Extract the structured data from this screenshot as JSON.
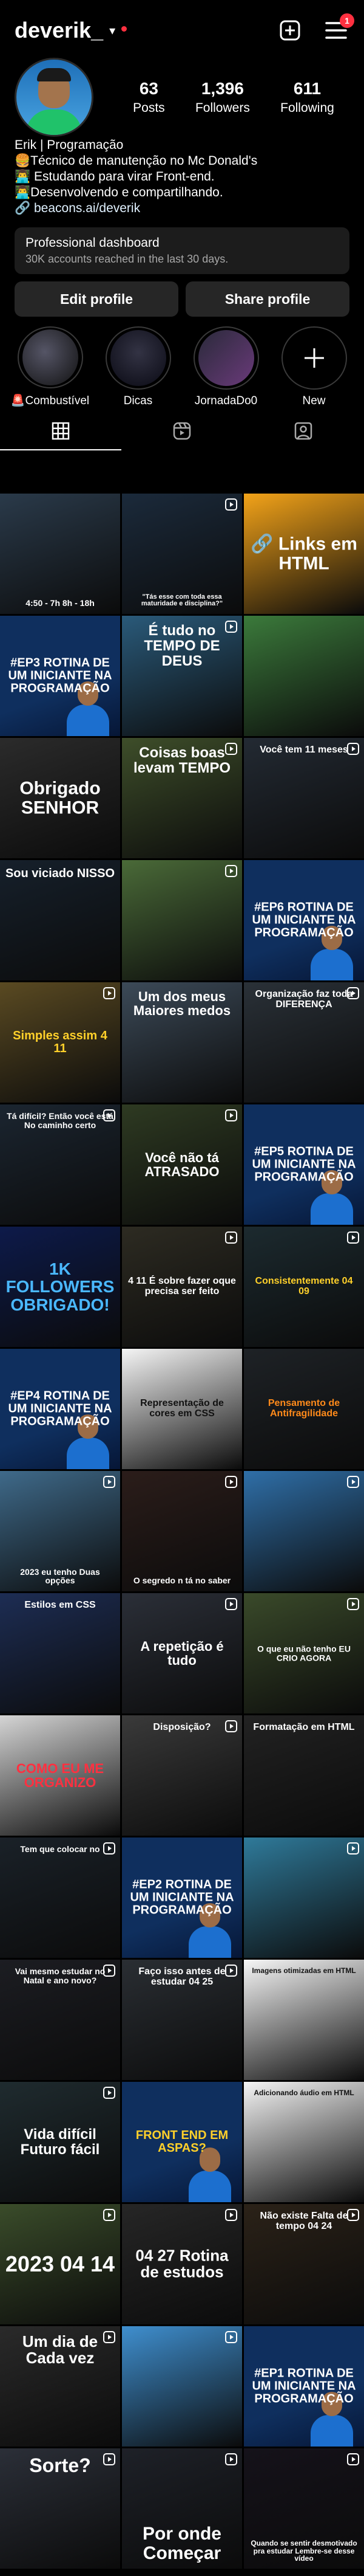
{
  "header": {
    "username": "deverik_",
    "notif_count": "1"
  },
  "stats": [
    {
      "num": "63",
      "label": "Posts"
    },
    {
      "num": "1,396",
      "label": "Followers"
    },
    {
      "num": "611",
      "label": "Following"
    }
  ],
  "bio": {
    "name": "Erik | Programação",
    "lines": [
      "🍔Técnico de manutenção no Mc Donald's",
      "👨‍💻 Estudando para virar Front-end.",
      "👨‍💻Desenvolvendo e compartilhando."
    ],
    "link": "🔗 beacons.ai/deverik"
  },
  "dashboard": {
    "title": "Professional dashboard",
    "subtitle": "30K accounts reached in the last 30 days."
  },
  "buttons": {
    "edit": "Edit profile",
    "share": "Share profile"
  },
  "highlights": [
    "🚨Combustível",
    "Dicas",
    "JornadaDo0",
    "New"
  ],
  "posts": [
    {
      "bg": "#2a3a4a",
      "text": "4:50 - 7h   8h - 18h",
      "size": 14,
      "pos": "bottom",
      "color": "#ffffff"
    },
    {
      "bg": "#1b2a3b",
      "text": "\"Tás esse com toda essa maturidade e disciplina?\"",
      "size": 11,
      "pos": "bottom",
      "color": "#ffffff",
      "reel": true
    },
    {
      "bg": "#f3a319",
      "text": "🔗 Links em HTML",
      "size": 30,
      "pos": "middle",
      "color": "#ffffff"
    },
    {
      "bg": "#0f2f5e",
      "text": "#EP3 ROTINA DE UM INICIANTE NA PROGRAMAÇÃO",
      "size": 20,
      "pos": "middle",
      "color": "#ffffff",
      "accent": "#ff3040"
    },
    {
      "bg": "#2a5a7a",
      "text": "É tudo no TEMPO DE DEUS",
      "size": 24,
      "pos": "top",
      "color": "#ffffff",
      "reel": true
    },
    {
      "bg": "#3b7a3b",
      "text": "",
      "size": 14,
      "pos": "bottom",
      "color": "#ffffff"
    },
    {
      "bg": "#2b2b2b",
      "text": "Obrigado SENHOR",
      "size": 30,
      "pos": "middle",
      "color": "#ffffff"
    },
    {
      "bg": "#3e4e2a",
      "text": "Coisas boas levam TEMPO",
      "size": 24,
      "pos": "top",
      "color": "#ffffff",
      "reel": true
    },
    {
      "bg": "#232a33",
      "text": "Você tem 11 meses",
      "size": 16,
      "pos": "top",
      "color": "#ffffff",
      "reel": true
    },
    {
      "bg": "#16202b",
      "text": "Sou viciado NISSO",
      "size": 20,
      "pos": "top",
      "color": "#ffffff"
    },
    {
      "bg": "#4a6a38",
      "text": "",
      "size": 14,
      "pos": "bottom",
      "color": "#ffffff",
      "reel": true
    },
    {
      "bg": "#0f2f5e",
      "text": "#EP6 ROTINA DE UM INICIANTE NA PROGRAMAÇÃO",
      "size": 20,
      "pos": "middle",
      "color": "#ffffff",
      "accent": "#ff3040"
    },
    {
      "bg": "#5a4a22",
      "text": "Simples assim 4 11",
      "size": 20,
      "pos": "middle",
      "color": "#ffd02a",
      "reel": true
    },
    {
      "bg": "#3c4a58",
      "text": "Um dos meus Maiores medos",
      "size": 22,
      "pos": "top",
      "color": "#ffffff"
    },
    {
      "bg": "#2a3138",
      "text": "Organização faz toda DIFERENÇA",
      "size": 16,
      "pos": "top",
      "color": "#ffffff",
      "reel": true
    },
    {
      "bg": "#1b2530",
      "text": "Tá difícil? Então você está No caminho certo",
      "size": 14,
      "pos": "top",
      "color": "#ffffff",
      "reel": true
    },
    {
      "bg": "#2e3a22",
      "text": "Você não tá ATRASADO",
      "size": 22,
      "pos": "middle",
      "color": "#ffffff",
      "reel": true
    },
    {
      "bg": "#0f2f5e",
      "text": "#EP5 ROTINA DE UM INICIANTE NA PROGRAMAÇÃO",
      "size": 20,
      "pos": "middle",
      "color": "#ffffff",
      "accent": "#ff3040"
    },
    {
      "bg": "#0d1a4a",
      "text": "1K FOLLOWERS OBRIGADO!",
      "size": 28,
      "pos": "middle",
      "color": "#4ab8ff"
    },
    {
      "bg": "#2d2b22",
      "text": "4 11 É sobre fazer oque precisa ser feito",
      "size": 16,
      "pos": "middle",
      "color": "#ffffff",
      "reel": true
    },
    {
      "bg": "#1c2a2f",
      "text": "Consistentemente 04 09",
      "size": 16,
      "pos": "middle",
      "color": "#ffd02a",
      "reel": true
    },
    {
      "bg": "#0f2f5e",
      "text": "#EP4 ROTINA DE UM INICIANTE NA PROGRAMAÇÃO",
      "size": 20,
      "pos": "middle",
      "color": "#ffffff",
      "accent": "#ff3040"
    },
    {
      "bg": "#f5f5f5",
      "text": "Representação de cores em CSS",
      "size": 16,
      "pos": "middle",
      "color": "#111111"
    },
    {
      "bg": "#1e2226",
      "text": "Pensamento de Antifragilidade",
      "size": 16,
      "pos": "middle",
      "color": "#ff8a1a"
    },
    {
      "bg": "#3f6a8a",
      "text": "2023 eu tenho Duas opções",
      "size": 14,
      "pos": "bottom",
      "color": "#ffffff",
      "reel": true
    },
    {
      "bg": "#2b1d1a",
      "text": "O segredo n tá no saber",
      "size": 14,
      "pos": "bottom",
      "color": "#ffffff",
      "reel": true
    },
    {
      "bg": "#2f6fa8",
      "text": "",
      "size": 14,
      "pos": "bottom",
      "color": "#ffffff",
      "reel": true
    },
    {
      "bg": "#1d2d54",
      "text": "Estilos em CSS",
      "size": 16,
      "pos": "top",
      "color": "#ffffff"
    },
    {
      "bg": "#2b2f38",
      "text": "A repetição é tudo",
      "size": 22,
      "pos": "middle",
      "color": "#ffffff",
      "reel": true
    },
    {
      "bg": "#3a4a2a",
      "text": "O que eu não tenho EU CRIO AGORA",
      "size": 14,
      "pos": "middle",
      "color": "#ffffff",
      "reel": true
    },
    {
      "bg": "#d5d5d5",
      "text": "COMO EU ME ORGANIZO",
      "size": 22,
      "pos": "middle",
      "color": "#ff3040"
    },
    {
      "bg": "#3a3a3a",
      "text": "Disposição?",
      "size": 16,
      "pos": "top",
      "color": "#ffffff",
      "reel": true
    },
    {
      "bg": "#222222",
      "text": "Formatação em HTML",
      "size": 16,
      "pos": "top",
      "color": "#ffffff"
    },
    {
      "bg": "#1a2128",
      "text": "Tem que colocar no",
      "size": 14,
      "pos": "top",
      "color": "#ffffff",
      "reel": true
    },
    {
      "bg": "#0f2f5e",
      "text": "#EP2 ROTINA DE UM INICIANTE NA PROGRAMAÇÃO",
      "size": 20,
      "pos": "middle",
      "color": "#ffffff",
      "accent": "#ff3040"
    },
    {
      "bg": "#2f7a9a",
      "text": "",
      "size": 14,
      "pos": "bottom",
      "color": "#ffffff",
      "reel": true
    },
    {
      "bg": "#1c1d22",
      "text": "Vai mesmo estudar no Natal e ano novo?",
      "size": 14,
      "pos": "top",
      "color": "#ffffff",
      "reel": true
    },
    {
      "bg": "#2a2e33",
      "text": "Faço isso antes de estudar 04 25",
      "size": 16,
      "pos": "top",
      "color": "#ffffff",
      "reel": true
    },
    {
      "bg": "#f7f7f7",
      "text": "Imagens otimizadas em HTML",
      "size": 12,
      "pos": "top",
      "color": "#111111"
    },
    {
      "bg": "#1f2b2f",
      "text": "Vida difícil Futuro fácil",
      "size": 24,
      "pos": "middle",
      "color": "#ffffff",
      "reel": true
    },
    {
      "bg": "#0f2f5e",
      "text": "FRONT END EM ASPAS?",
      "size": 20,
      "pos": "middle",
      "color": "#ffd02a",
      "accent": "#ff3040"
    },
    {
      "bg": "#f5f5f5",
      "text": "Adicionando áudio em HTML",
      "size": 12,
      "pos": "top",
      "color": "#111111"
    },
    {
      "bg": "#3a4c2a",
      "text": "2023 04 14",
      "size": 36,
      "pos": "middle",
      "color": "#ffffff",
      "reel": true
    },
    {
      "bg": "#262626",
      "text": "04 27 Rotina de estudos",
      "size": 26,
      "pos": "middle",
      "color": "#ffffff",
      "reel": true
    },
    {
      "bg": "#2b2218",
      "text": "Não existe Falta de tempo 04 24",
      "size": 16,
      "pos": "top",
      "color": "#ffffff",
      "reel": true
    },
    {
      "bg": "#2a2a2a",
      "text": "Um dia de Cada vez",
      "size": 26,
      "pos": "top",
      "color": "#ffffff",
      "reel": true
    },
    {
      "bg": "#3f8fcf",
      "text": "",
      "size": 14,
      "pos": "bottom",
      "color": "#ffffff",
      "reel": true
    },
    {
      "bg": "#0f2f5e",
      "text": "#EP1 ROTINA DE UM INICIANTE NA PROGRAMAÇÃO",
      "size": 20,
      "pos": "middle",
      "color": "#ffffff",
      "accent": "#ff3040"
    },
    {
      "bg": "#2b2f38",
      "text": "Sorte?",
      "size": 32,
      "pos": "top",
      "color": "#ffffff",
      "reel": true
    },
    {
      "bg": "#1e2128",
      "text": "Por onde Começar",
      "size": 30,
      "pos": "bottom",
      "color": "#ffffff",
      "reel": true
    },
    {
      "bg": "#15121a",
      "text": "Quando se sentir desmotivado pra estudar Lembre-se desse vídeo",
      "size": 12,
      "pos": "bottom",
      "color": "#ffffff",
      "reel": true
    }
  ]
}
